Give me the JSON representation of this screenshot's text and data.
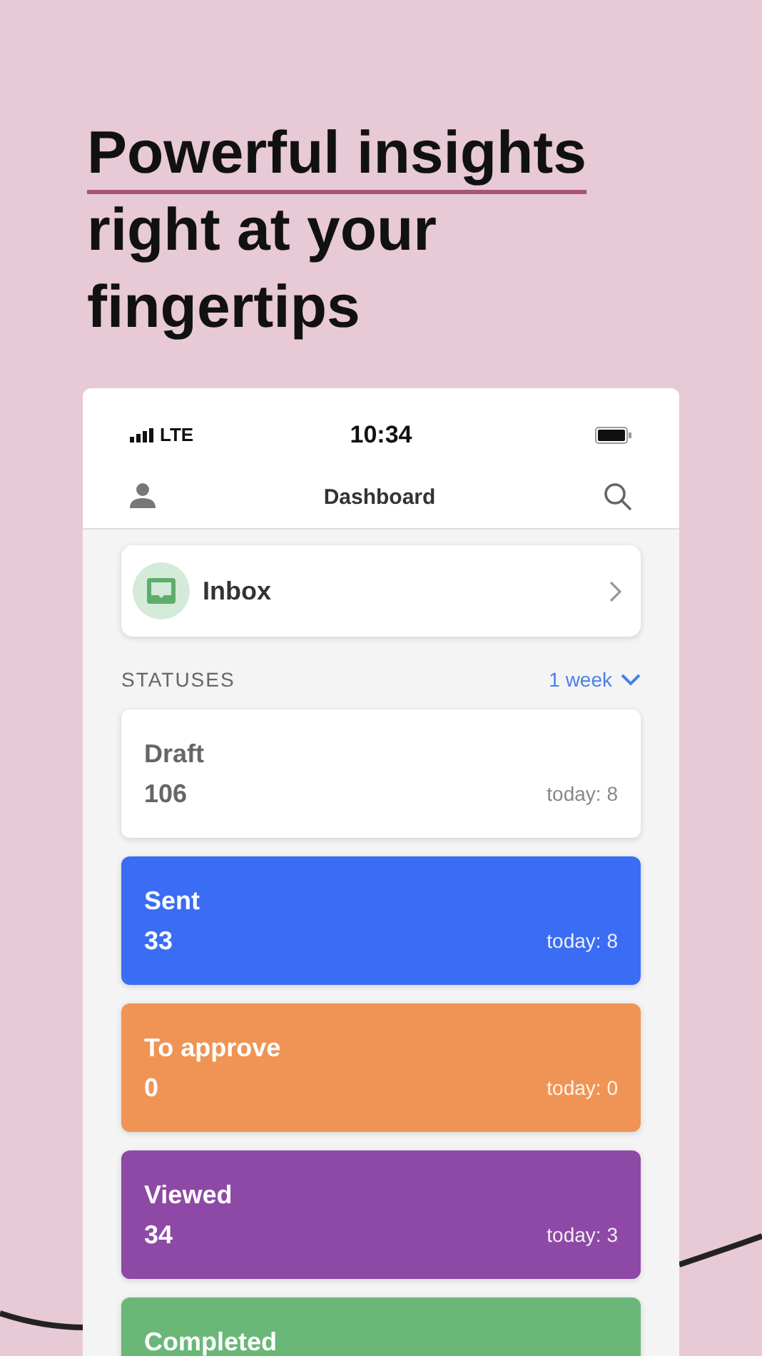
{
  "headline": "Powerful insights right at your fingertips",
  "status_bar": {
    "network": "LTE",
    "time": "10:34"
  },
  "nav": {
    "title": "Dashboard"
  },
  "inbox": {
    "label": "Inbox"
  },
  "statuses": {
    "heading": "STATUSES",
    "period": "1 week",
    "items": [
      {
        "name": "Draft",
        "count": "106",
        "today": "today: 8",
        "kind": "plain",
        "color": "#ffffff"
      },
      {
        "name": "Sent",
        "count": "33",
        "today": "today: 8",
        "kind": "solid",
        "color": "#3a6cf4"
      },
      {
        "name": "To approve",
        "count": "0",
        "today": "today: 0",
        "kind": "solid",
        "color": "#f09455"
      },
      {
        "name": "Viewed",
        "count": "34",
        "today": "today: 3",
        "kind": "solid",
        "color": "#8e48a6"
      },
      {
        "name": "Completed",
        "kind": "solid",
        "color": "#6ab778"
      }
    ]
  }
}
